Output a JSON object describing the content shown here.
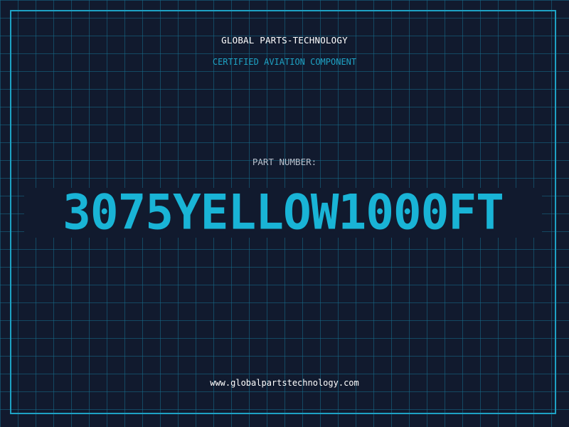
{
  "company_name": "GLOBAL PARTS-TECHNOLOGY",
  "subtitle": "CERTIFIED AVIATION COMPONENT",
  "part_label": "PART NUMBER:",
  "part_number": "3075YELLOW1000FT",
  "website": "www.globalpartstechnology.com",
  "colors": {
    "background": "#111a2e",
    "grid": "#166e8c",
    "accent": "#1ea2c4",
    "part_number": "#19b4d6",
    "text": "#ffffff",
    "label": "#b8c0cc"
  }
}
